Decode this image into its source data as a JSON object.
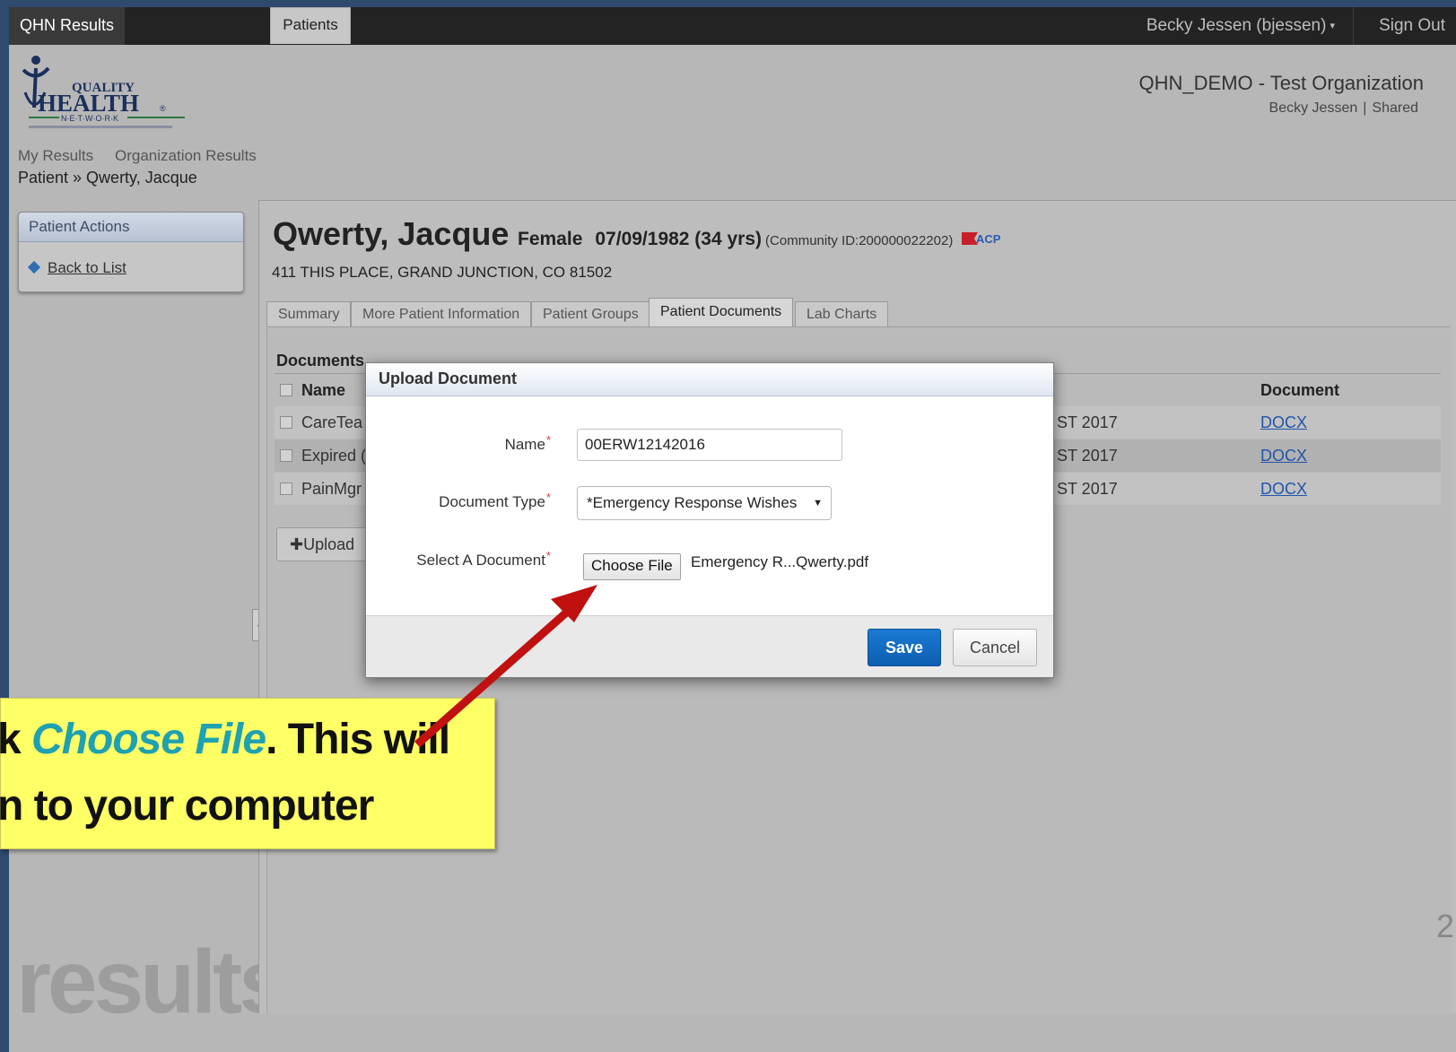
{
  "topbar": {
    "app_name": "QHN Results",
    "user_menu": "Becky Jessen (bjessen)",
    "sign_out": "Sign Out"
  },
  "header": {
    "org_name": "QHN_DEMO - Test Organization",
    "user_name": "Becky Jessen",
    "user_scope": "Shared"
  },
  "nav": {
    "items": [
      "My Results",
      "Organization Results",
      "Patients"
    ],
    "active": "Patients"
  },
  "breadcrumb": "Patient » Qwerty, Jacque",
  "sidebar": {
    "title": "Patient Actions",
    "back_link": "Back to List"
  },
  "patient": {
    "name": "Qwerty, Jacque",
    "sex": "Female",
    "dob": "07/09/1982 (34 yrs)",
    "community_id": "(Community ID:200000022202)",
    "address": "411 THIS PLACE, GRAND JUNCTION, CO 81502"
  },
  "tabs": [
    "Summary",
    "More Patient Information",
    "Patient Groups",
    "Patient Documents",
    "Lab Charts"
  ],
  "documents": {
    "title": "Documents",
    "columns": [
      "Name",
      "Document"
    ],
    "rows": [
      {
        "name": "CareTea",
        "date": "ST 2017",
        "doc": "DOCX"
      },
      {
        "name": "Expired (",
        "date": "ST 2017",
        "doc": "DOCX"
      },
      {
        "name": "PainMgr",
        "date": "ST 2017",
        "doc": "DOCX"
      }
    ],
    "upload_label": "Upload"
  },
  "modal": {
    "title": "Upload Document",
    "name_label": "Name",
    "name_value": "00ERW12142016",
    "type_label": "Document Type",
    "type_value": "*Emergency Response Wishes",
    "file_label": "Select A Document",
    "file_button": "Choose File",
    "file_name": "Emergency R...Qwerty.pdf",
    "save": "Save",
    "cancel": "Cancel",
    "required_mark": "*"
  },
  "callout": {
    "line1_prefix": "k ",
    "line1_accent": "Choose File",
    "line1_suffix": ".  This will",
    "line2": "n to your computer"
  },
  "watermark": "results",
  "page_number": "2",
  "colors": {
    "callout_bg": "#ffff66",
    "accent_text": "#1ea1b1",
    "save_button": "#0d5eb0",
    "arrow": "#c01010"
  }
}
